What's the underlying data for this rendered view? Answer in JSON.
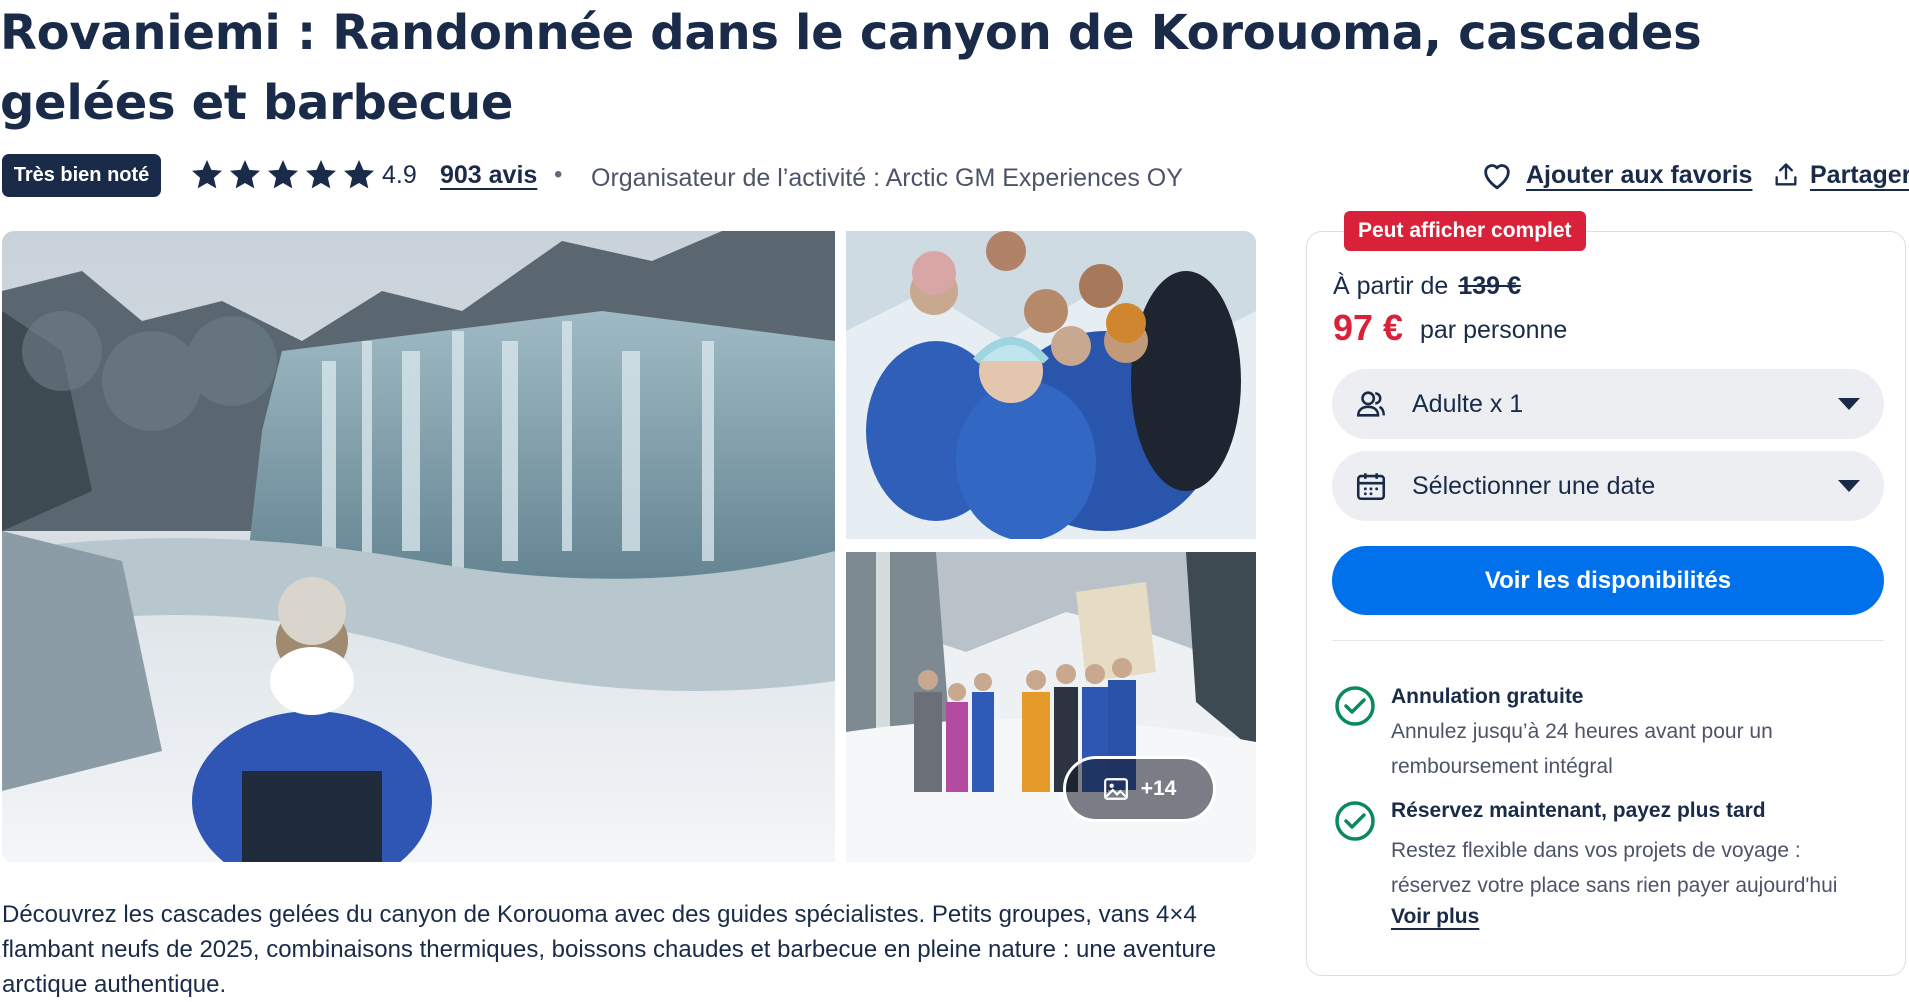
{
  "header": {
    "title": "Rovaniemi : Randonnée dans le canyon de Korouoma, cascades gelées et barbecue",
    "badge": "Très bien noté",
    "rating": "4.9",
    "reviews": "903 avis",
    "separator": "•",
    "organizer": "Organisateur de l’activité : Arctic GM Experiences OY",
    "favorite_label": "Ajouter aux favoris",
    "share_label": "Partager",
    "stars_count": 5
  },
  "gallery": {
    "more_photos_label": "+14",
    "main_photo": "frozen-waterfall-canyon-photo",
    "top_photo": "group-selfie-snow-photo",
    "bottom_photo": "group-in-snowy-canyon-photo"
  },
  "description": "Découvrez les cascades gelées du canyon de Korouoma avec des guides spécialistes. Petits groupes, vans 4×4 flambant neufs de 2025, combinaisons thermiques, boissons chaudes et barbecue en pleine nature : une aventure arctique authentique.",
  "booking": {
    "sellout_badge": "Peut afficher complet",
    "from_label": "À partir de",
    "old_price": "139 €",
    "price": "97 €",
    "per_person": "par personne",
    "participants": "Adulte x 1",
    "date_placeholder": "Sélectionner une date",
    "cta": "Voir les disponibilités",
    "benefits": [
      {
        "title": "Annulation gratuite",
        "text": "Annulez jusqu’à 24 heures avant pour un remboursement intégral"
      },
      {
        "title": "Réservez maintenant, payez plus tard",
        "text": "Restez flexible dans vos projets de voyage : réservez votre place sans rien payer aujourd'hui"
      }
    ],
    "see_more": "Voir plus"
  },
  "colors": {
    "navy": "#1a2b49",
    "red": "#d9223a",
    "blue": "#0071eb",
    "green": "#0a8a5a",
    "grey_bg": "#eceef1"
  },
  "icons": [
    "star-icon",
    "heart-icon",
    "share-icon",
    "gallery-icon",
    "user-group-icon",
    "calendar-icon",
    "caret-down-icon",
    "check-circle-icon"
  ]
}
